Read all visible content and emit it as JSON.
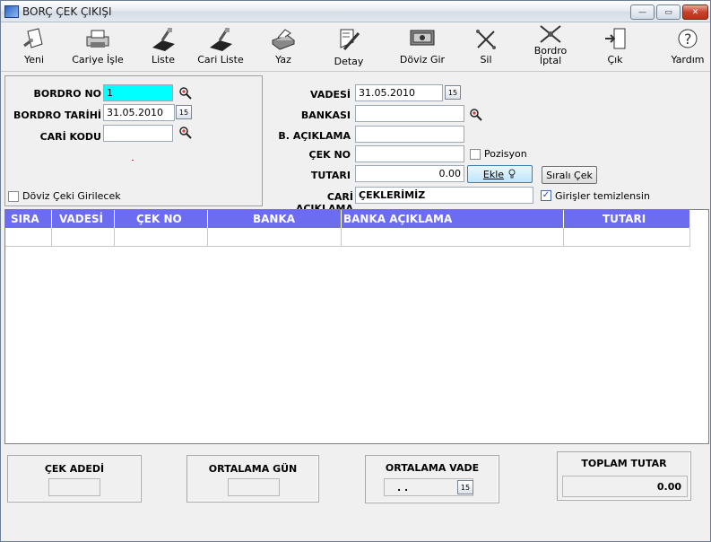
{
  "window": {
    "title": "BORÇ ÇEK ÇIKIŞI",
    "close_glyph": "✕",
    "minimize_glyph": "—",
    "maximize_glyph": "▭"
  },
  "toolbar": {
    "items": [
      {
        "label": "Yeni",
        "icon": "new-doc-icon"
      },
      {
        "label": "Cariye İşle",
        "icon": "printer-process-icon"
      },
      {
        "label": "Liste",
        "icon": "list-icon"
      },
      {
        "label": "Cari Liste",
        "icon": "cari-list-icon"
      },
      {
        "label": "Yaz",
        "icon": "print-icon"
      },
      {
        "label": "Detay",
        "icon": "detail-icon"
      },
      {
        "label": "Döviz Gir",
        "icon": "currency-icon"
      },
      {
        "label": "Sil",
        "icon": "delete-icon"
      },
      {
        "label": "Bordro İptal",
        "icon": "cancel-icon"
      },
      {
        "label": "Çık",
        "icon": "exit-icon"
      },
      {
        "label": "Yardım",
        "icon": "help-icon"
      }
    ]
  },
  "left_form": {
    "bordro_no_label": "BORDRO NO",
    "bordro_no_value": "1",
    "bordro_tarihi_label": "BORDRO TARİHİ",
    "bordro_tarihi_value": "31.05.2010",
    "cari_kodu_label": "CARİ KODU",
    "cari_kodu_value": "",
    "doviz_label": "Döviz Çeki Girilecek",
    "doviz_checked": false
  },
  "right_form": {
    "vadesi_label": "VADESİ",
    "vadesi_value": "31.05.2010",
    "bankasi_label": "BANKASI",
    "bankasi_value": "",
    "b_aciklama_label": "B. AÇIKLAMA",
    "b_aciklama_value": "",
    "cek_no_label": "ÇEK NO",
    "cek_no_value": "",
    "pozisyon_label": "Pozisyon",
    "tutari_label": "TUTARI",
    "tutari_value": "0.00",
    "ekle_label": "Ekle",
    "sirali_cek_label": "Sıralı Çek",
    "cari_aciklama_label": "CARİ AÇIKLAMA",
    "cari_aciklama_value": "ÇEKLERİMİZ",
    "girisler_label": "Girişler temizlensin",
    "girisler_checked": true
  },
  "calendar_glyph": "15",
  "grid": {
    "columns": [
      "SIRA",
      "VADESİ",
      "ÇEK NO",
      "BANKA",
      "BANKA AÇIKLAMA",
      "TUTARI"
    ],
    "rows": [
      [
        "",
        "",
        "",
        "",
        "",
        ""
      ]
    ]
  },
  "summary": {
    "cek_adedi_label": "ÇEK ADEDİ",
    "cek_adedi_value": "",
    "ortalama_gun_label": "ORTALAMA GÜN",
    "ortalama_gun_value": "",
    "ortalama_vade_label": "ORTALAMA VADE",
    "ortalama_vade_value": ". .",
    "toplam_tutar_label": "TOPLAM TUTAR",
    "toplam_tutar_value": "0.00"
  },
  "colors": {
    "grid_header": "#6c6cf0",
    "bordro_no_highlight": "#00ffff"
  }
}
